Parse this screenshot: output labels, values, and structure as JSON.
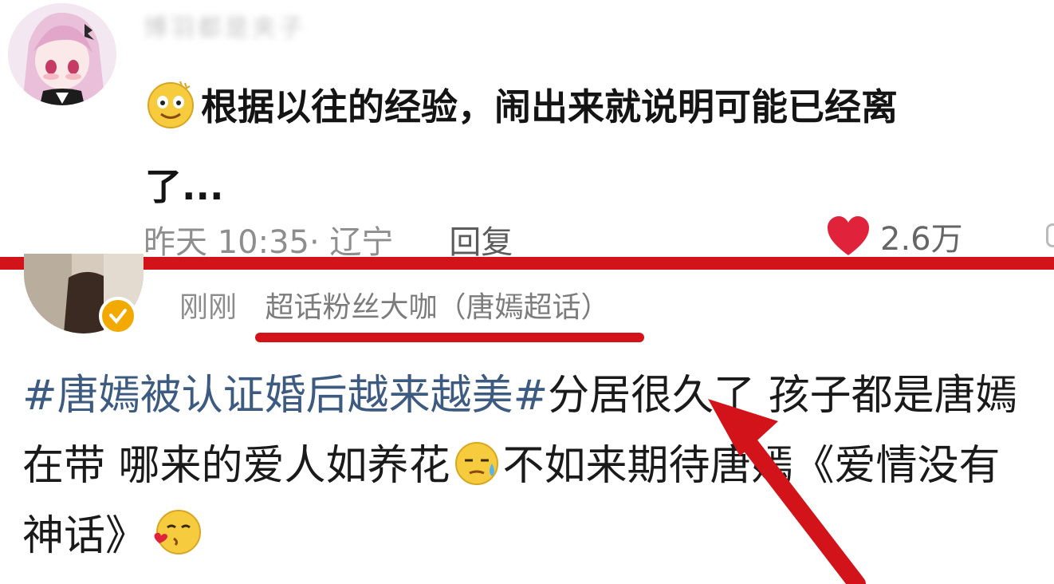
{
  "top_comment": {
    "username_blurred": "博羽都是夹子",
    "emoji_1": "smile-emoji",
    "text_line1": "根据以往的经验，闹出来就说明可能已经离",
    "text_line2": "了...",
    "time_location": "昨天 10:35· 辽宁",
    "reply_label": "回复",
    "like_icon": "heart-icon",
    "like_count": "2.6万"
  },
  "bottom_post": {
    "time": "刚刚",
    "tag": "超话粉丝大咖（唐嫣超话）",
    "hashtag": "#唐嫣被认证婚后越来越美#",
    "text_1": "分居很久了 孩子都是唐嫣在带 哪来的爱人如养花",
    "emoji_2": "sweat-emoji",
    "text_2": "不如来期待唐嫣《爱情没有神话》",
    "emoji_3": "kiss-emoji"
  },
  "colors": {
    "accent_red": "#d2141a",
    "hashtag_blue": "#3d5a80",
    "heart_red": "#e0233a",
    "verified_gold": "#f2a900"
  }
}
